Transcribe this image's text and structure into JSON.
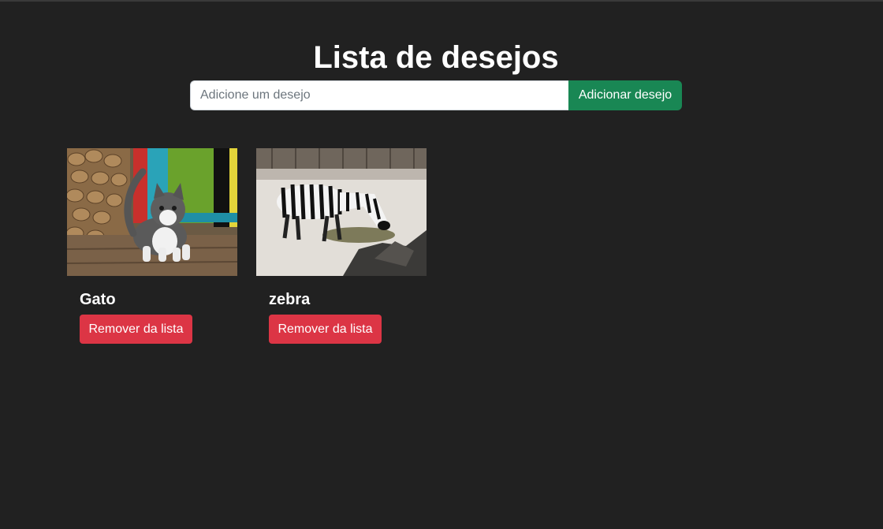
{
  "header": {
    "title": "Lista de desejos"
  },
  "form": {
    "placeholder": "Adicione um desejo",
    "value": "",
    "add_label": "Adicionar desejo"
  },
  "wishes": [
    {
      "title": "Gato",
      "image": "kitten-photo",
      "remove_label": "Remover da lista"
    },
    {
      "title": "zebra",
      "image": "zebra-photo",
      "remove_label": "Remover da lista"
    }
  ],
  "colors": {
    "background": "#212121",
    "add_button": "#198754",
    "remove_button": "#dc3545"
  }
}
